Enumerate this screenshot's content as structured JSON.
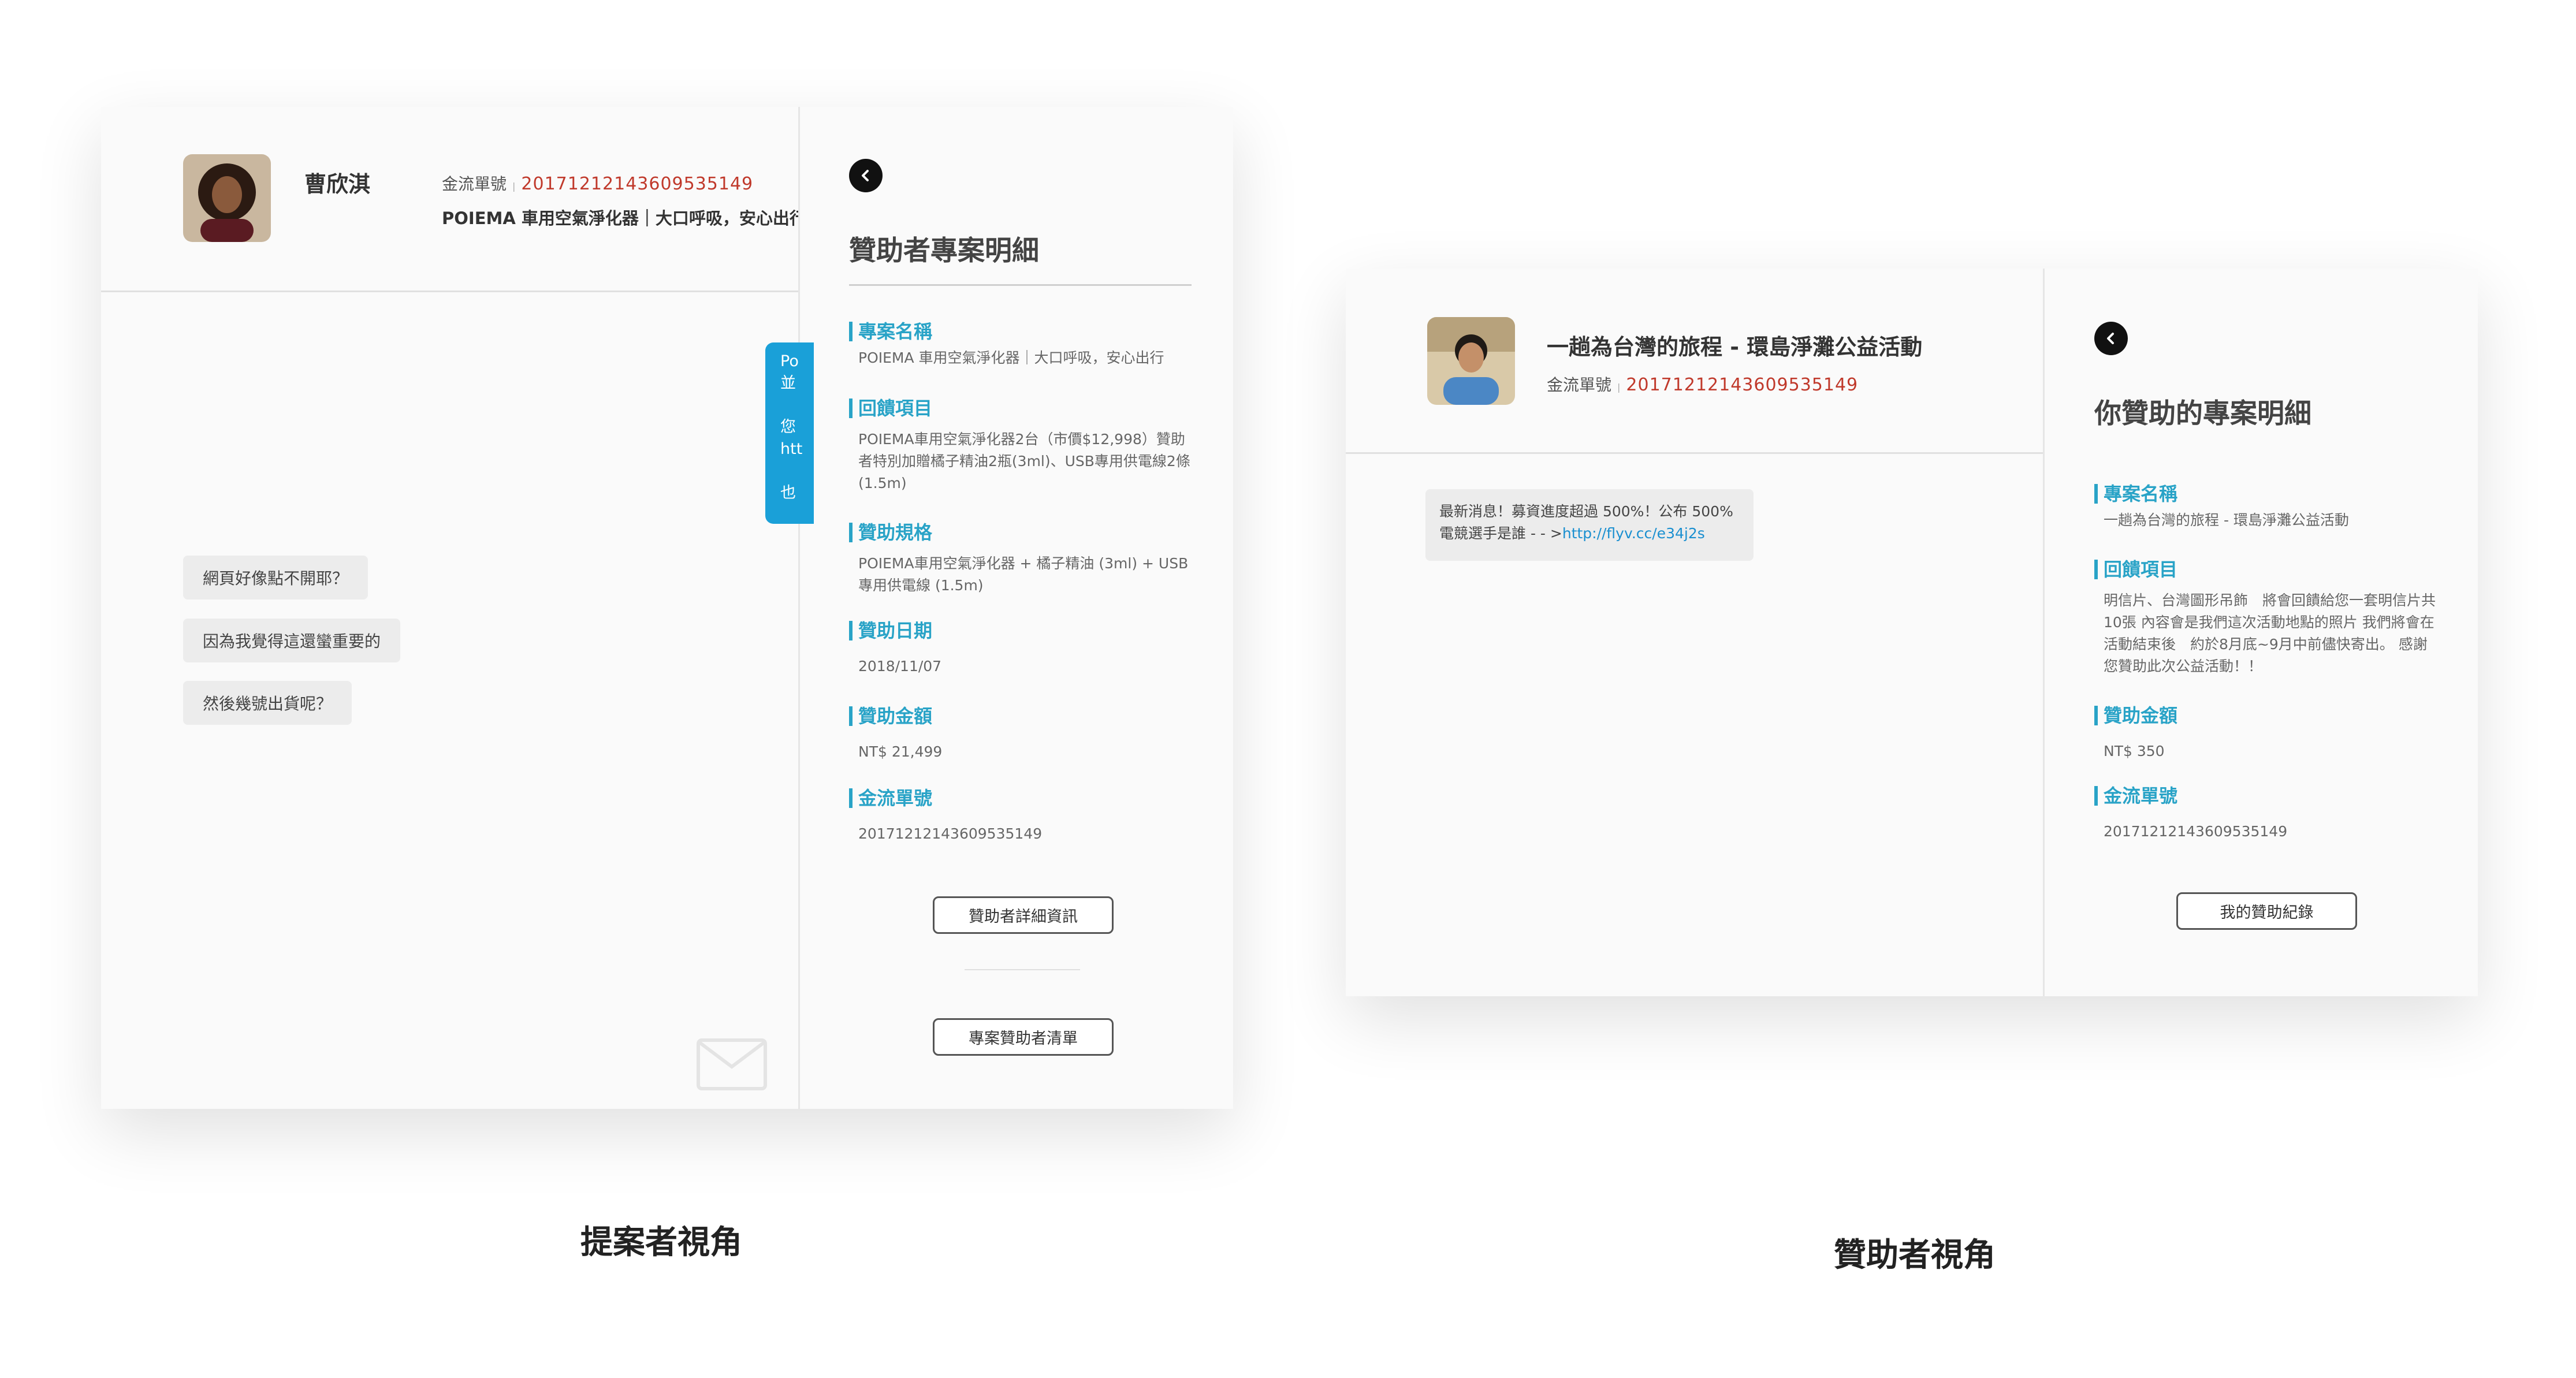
{
  "proposer": {
    "customer_name": "曹欣淇",
    "order_label": "金流單號",
    "order_no": "20171212143609535149",
    "project_name_bold": "POIEMA 車用空氣淨化器｜大口呼吸，安心出行",
    "chat_blue_lines": [
      "Po",
      "並",
      "",
      "您",
      "htt",
      "",
      "也"
    ],
    "chat_messages": [
      "網頁好像點不開耶？",
      "因為我覺得這還蠻重要的",
      "然後幾號出貨呢？"
    ],
    "panel_title": "贊助者專案明細",
    "sections": [
      {
        "heading": "專案名稱",
        "body": "POIEMA 車用空氣淨化器｜大口呼吸，安心出行"
      },
      {
        "heading": "回饋項目",
        "body": "POIEMA車用空氣淨化器2台（市價$12,998）贊助者特別加贈橘子精油2瓶(3ml)、USB專用供電線2條(1.5m)"
      },
      {
        "heading": "贊助規格",
        "body": "POIEMA車用空氣淨化器 + 橘子精油 (3ml) + USB專用供電線 (1.5m)"
      },
      {
        "heading": "贊助日期",
        "body": "2018/11/07"
      },
      {
        "heading": "贊助金額",
        "body": "NT$ 21,499"
      },
      {
        "heading": "金流單號",
        "body": "20171212143609535149"
      }
    ],
    "btn_detail": "贊助者詳細資訊",
    "btn_list": "專案贊助者清單",
    "caption": "提案者視角"
  },
  "sponsor": {
    "project_title": "一趟為台灣的旅程 - 環島淨灘公益活動",
    "order_label": "金流單號",
    "order_no": "20171212143609535149",
    "message_text": "最新消息！募資進度超過 500%！公布 500% 電競選手是誰 - - >",
    "message_link": "http://flyv.cc/e34j2s",
    "panel_title": "你贊助的專案明細",
    "sections": [
      {
        "heading": "專案名稱",
        "body": "一趟為台灣的旅程 - 環島淨灘公益活動"
      },
      {
        "heading": "回饋項目",
        "body": "明信片、台灣圖形吊飾　將會回饋給您一套明信片共10張 內容會是我們這次活動地點的照片 我們將會在活動結束後　約於8月底~9月中前儘快寄出。 感謝您贊助此次公益活動！！"
      },
      {
        "heading": "贊助金額",
        "body": "NT$ 350"
      },
      {
        "heading": "金流單號",
        "body": "20171212143609535149"
      }
    ],
    "btn_records": "我的贊助紀錄",
    "caption": "贊助者視角"
  },
  "icons": {
    "back": "chevron-left-icon",
    "mail": "envelope-icon",
    "avatar_a": "person-avatar-curly-hair",
    "avatar_b": "person-avatar-outdoor"
  },
  "colors": {
    "accent": "#29a3c7",
    "order_red": "#c0392b",
    "chat_blue": "#1aa0d8",
    "link": "#1a8fd0"
  }
}
